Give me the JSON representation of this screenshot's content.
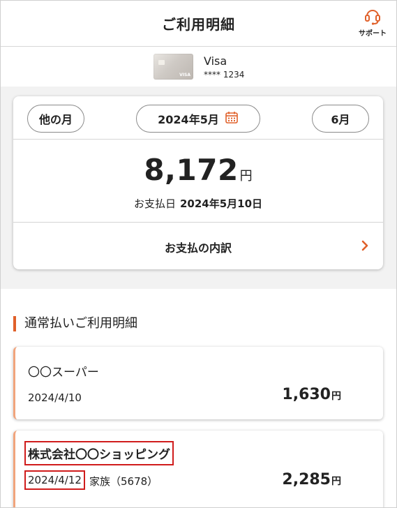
{
  "header": {
    "title": "ご利用明細",
    "support_label": "サポート"
  },
  "card": {
    "brand": "Visa",
    "number": "**** 1234",
    "image_brand_text": "VISA"
  },
  "month_nav": {
    "prev_label": "他の月",
    "current_label": "2024年5月",
    "next_label": "6月"
  },
  "summary": {
    "amount": "8,172",
    "currency": "円",
    "due_label": "お支払日",
    "due_date": "2024年5月10日"
  },
  "breakdown": {
    "label": "お支払の内訳"
  },
  "section": {
    "title": "通常払いご利用明細"
  },
  "transactions": [
    {
      "merchant": "〇〇スーパー",
      "date": "2024/4/10",
      "member": "",
      "amount": "1,630",
      "currency": "円"
    },
    {
      "merchant": "株式会社〇〇ショッピング",
      "date": "2024/4/12",
      "member": "家族（5678）",
      "amount": "2,285",
      "currency": "円"
    }
  ],
  "colors": {
    "accent": "#e0602a",
    "highlight": "#d01c1c",
    "card_border": "#f1a47c"
  }
}
